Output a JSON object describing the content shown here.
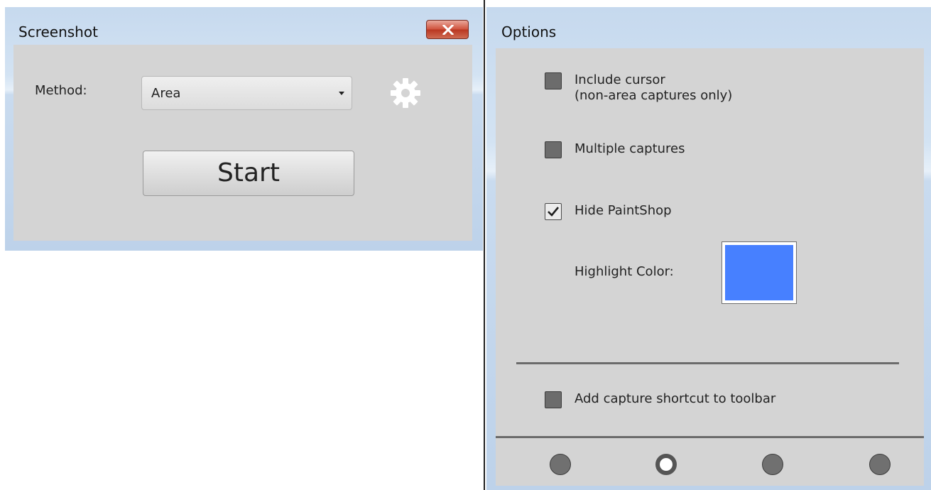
{
  "screenshot": {
    "title": "Screenshot",
    "method_label": "Method:",
    "method_value": "Area",
    "start_label": "Start"
  },
  "options": {
    "title": "Options",
    "include_cursor": {
      "line1": "Include cursor",
      "line2": "(non-area captures only)",
      "checked": false
    },
    "multiple_captures": {
      "label": "Multiple captures",
      "checked": false
    },
    "hide_paintshop": {
      "label": "Hide PaintShop",
      "checked": true
    },
    "highlight_color_label": "Highlight Color:",
    "highlight_color": "#4780ff",
    "add_shortcut": {
      "label": "Add capture shortcut to toolbar",
      "checked": false
    },
    "pager": {
      "count": 4,
      "active_index": 1
    }
  }
}
